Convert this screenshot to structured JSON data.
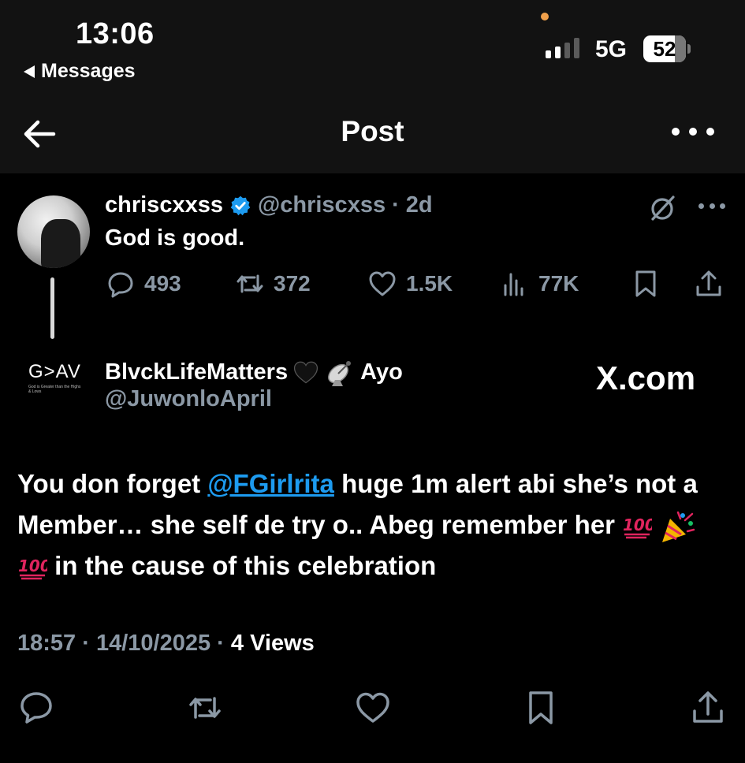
{
  "status_bar": {
    "time": "13:06",
    "back_app": "Messages",
    "network": "5G",
    "battery": "52"
  },
  "nav": {
    "title": "Post"
  },
  "post": {
    "display_name": "chriscxxss",
    "handle": "@chriscxss",
    "age": "2d",
    "text": "God is good.",
    "metrics": {
      "replies": "493",
      "reposts": "372",
      "likes": "1.5K",
      "views": "77K"
    }
  },
  "quote": {
    "logo_text": "G>AV",
    "logo_tagline": "God is Greater than the Highs & Lows",
    "display_name": "BlvckLifeMatters",
    "name_suffix": "Ayo",
    "handle": "@JuwonloApril",
    "watermark": "X.com",
    "text_before": "You don forget ",
    "mention": "@FGirlrita",
    "text_after": " huge 1m alert abi she’s not a Member… she self de try o.. Abeg remember her",
    "text_end": " in the cause of this celebration",
    "time": "18:57",
    "date": "14/10/2025",
    "views": "4 Views"
  },
  "colors": {
    "background": "#000000",
    "bar": "#121212",
    "muted": "#8b98a5",
    "link": "#1d9bf0",
    "verified": "#1d9bf0"
  }
}
